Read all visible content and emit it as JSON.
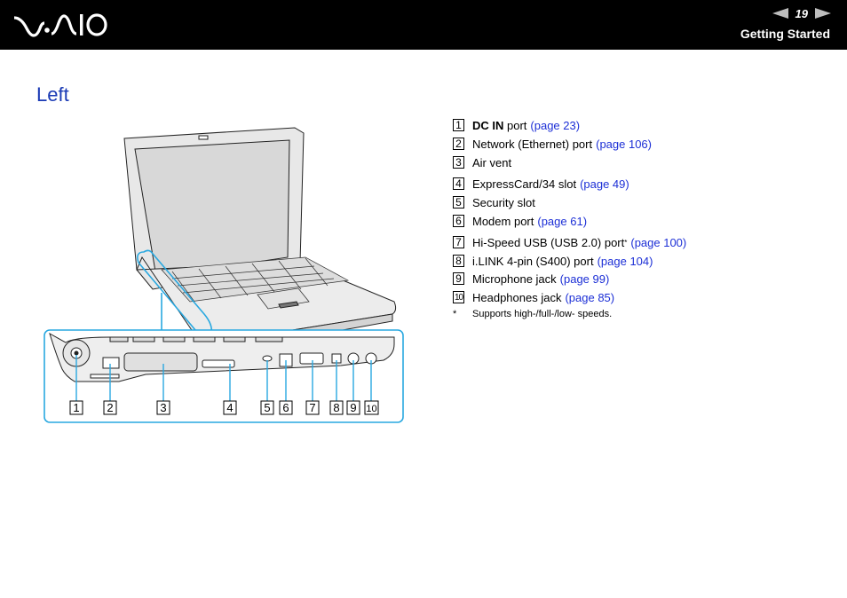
{
  "header": {
    "logo": "VAIO",
    "page_number": "19",
    "section": "Getting Started",
    "prev_icon": "prev-page-arrow-icon",
    "next_icon": "next-page-arrow-icon"
  },
  "page": {
    "title": "Left"
  },
  "illustration": {
    "description": "Laptop left side view with callout",
    "callout_color": "#29a8e0",
    "callout_numbers": [
      "1",
      "2",
      "3",
      "4",
      "5",
      "6",
      "7",
      "8",
      "9",
      "10"
    ]
  },
  "items": [
    {
      "num": "1",
      "bold": "DC IN",
      "text": " port",
      "link": "(page 23)"
    },
    {
      "num": "2",
      "bold": "",
      "text": "Network (Ethernet) port",
      "link": "(page 106)"
    },
    {
      "num": "3",
      "bold": "",
      "text": "Air vent",
      "link": ""
    },
    {
      "num": "4",
      "bold": "",
      "text": "ExpressCard/34 slot",
      "link": "(page 49)"
    },
    {
      "num": "5",
      "bold": "",
      "text": "Security slot",
      "link": ""
    },
    {
      "num": "6",
      "bold": "",
      "text": "Modem port",
      "link": "(page 61)"
    },
    {
      "num": "7",
      "bold": "",
      "text": "Hi-Speed USB (USB 2.0) port",
      "sup": "*",
      "link": "(page 100)"
    },
    {
      "num": "8",
      "bold": "",
      "text": "i.LINK 4-pin (S400) port",
      "link": "(page 104)"
    },
    {
      "num": "9",
      "bold": "",
      "text": "Microphone jack",
      "link": "(page 99)"
    },
    {
      "num": "10",
      "bold": "",
      "text": "Headphones jack",
      "link": "(page 85)"
    }
  ],
  "footnote": {
    "marker": "*",
    "text": "Supports high-/full-/low- speeds."
  },
  "colors": {
    "header_bg": "#000000",
    "title": "#1a3ab5",
    "link": "#1c2fd6",
    "callout": "#29a8e0"
  }
}
